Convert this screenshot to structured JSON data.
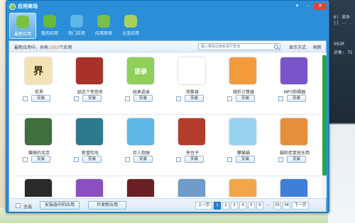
{
  "window": {
    "title": "应用商场",
    "controls": [
      "▾",
      "–",
      "✕"
    ]
  },
  "nav": {
    "items": [
      {
        "label": "最新应用",
        "icon": "sun-shield-icon",
        "color": "#7bc243",
        "active": true
      },
      {
        "label": "我的应用",
        "icon": "person-icon",
        "color": "#6ab93a",
        "active": false
      },
      {
        "label": "热门应用",
        "icon": "flower-icon",
        "color": "#5cb6e8",
        "active": false
      },
      {
        "label": "应用商场",
        "icon": "store-icon",
        "color": "#78c04a",
        "active": false
      },
      {
        "label": "元宝应用",
        "icon": "coin-icon",
        "color": "#a6d45a",
        "active": false
      }
    ]
  },
  "header": {
    "crumb_prefix": "最新应用中，共有",
    "crumb_count": "1053",
    "crumb_suffix": "个应用",
    "search_placeholder": "输入相关应用名进行查询",
    "view_mode": "显示方式",
    "refresh": "刷新"
  },
  "apps": [
    {
      "name": "贫界",
      "icon": "calligraphy-icon",
      "glyph": "界",
      "bg": "#f3e2b3",
      "fg": "#3b2a10"
    },
    {
      "name": "励志个性签名",
      "icon": "book-icon",
      "glyph": "",
      "bg": "#a8322a",
      "fg": "#fff"
    },
    {
      "name": "经典语录",
      "icon": "quotes-icon",
      "glyph": "语录",
      "bg": "#8fcf5a",
      "fg": "#fff"
    },
    {
      "name": "简繁易",
      "icon": "swirl-icon",
      "glyph": "",
      "bg": "#ffffff",
      "fg": "#c0282a"
    },
    {
      "name": "微折计算器",
      "icon": "calculator-icon",
      "glyph": "",
      "bg": "#f39a3c",
      "fg": "#fff"
    },
    {
      "name": "MP3剪辑器",
      "icon": "music-icon",
      "glyph": "",
      "bg": "#7a54c9",
      "fg": "#fff"
    },
    {
      "name": "蝶蛛的北京",
      "icon": "tree-icon",
      "glyph": "",
      "bg": "#3f6f3a",
      "fg": "#fff"
    },
    {
      "name": "新冒险岛",
      "icon": "fantasy-icon",
      "glyph": "",
      "bg": "#2d7a8e",
      "fg": "#fff"
    },
    {
      "name": "巨人炮弹",
      "icon": "rocket-icon",
      "glyph": "",
      "bg": "#5db8e6",
      "fg": "#fff"
    },
    {
      "name": "夹豆子",
      "icon": "bean-icon",
      "glyph": "",
      "bg": "#b53c2a",
      "fg": "#fff"
    },
    {
      "name": "攀猫猫",
      "icon": "snow-icon",
      "glyph": "",
      "bg": "#9ad3f0",
      "fg": "#fff"
    },
    {
      "name": "猫和老鼠抢东西",
      "icon": "cartoon-icon",
      "glyph": "",
      "bg": "#e58f3a",
      "fg": "#fff"
    },
    {
      "name": "",
      "icon": "portrait-icon",
      "glyph": "",
      "bg": "#2a2a2a",
      "fg": "#fff"
    },
    {
      "name": "",
      "icon": "bubbles-icon",
      "glyph": "",
      "bg": "#8b4fc2",
      "fg": "#fff"
    },
    {
      "name": "",
      "icon": "dark-game-icon",
      "glyph": "",
      "bg": "#6a1f24",
      "fg": "#fff"
    },
    {
      "name": "",
      "icon": "photo-icon",
      "glyph": "",
      "bg": "#6f9cc9",
      "fg": "#fff"
    },
    {
      "name": "",
      "icon": "sunset-icon",
      "glyph": "",
      "bg": "#f2a64a",
      "fg": "#fff"
    },
    {
      "name": "",
      "icon": "blue-game-icon",
      "glyph": "",
      "bg": "#3e7fd9",
      "fg": "#fff"
    }
  ],
  "install_label": "安装",
  "footer": {
    "select_all": "全选",
    "install_selected": "安装选中的应用",
    "dev_apps": "开发新应用",
    "pager": {
      "prev": "上一页",
      "pages": [
        "1",
        "2",
        "3",
        "4",
        "5",
        "6",
        "...",
        "35",
        "36"
      ],
      "current": "1",
      "next": "下一页"
    }
  },
  "background": {
    "right_lines": [
      "6) 读命",
      "|| -- .",
      "992M",
      "对象: 75"
    ]
  }
}
